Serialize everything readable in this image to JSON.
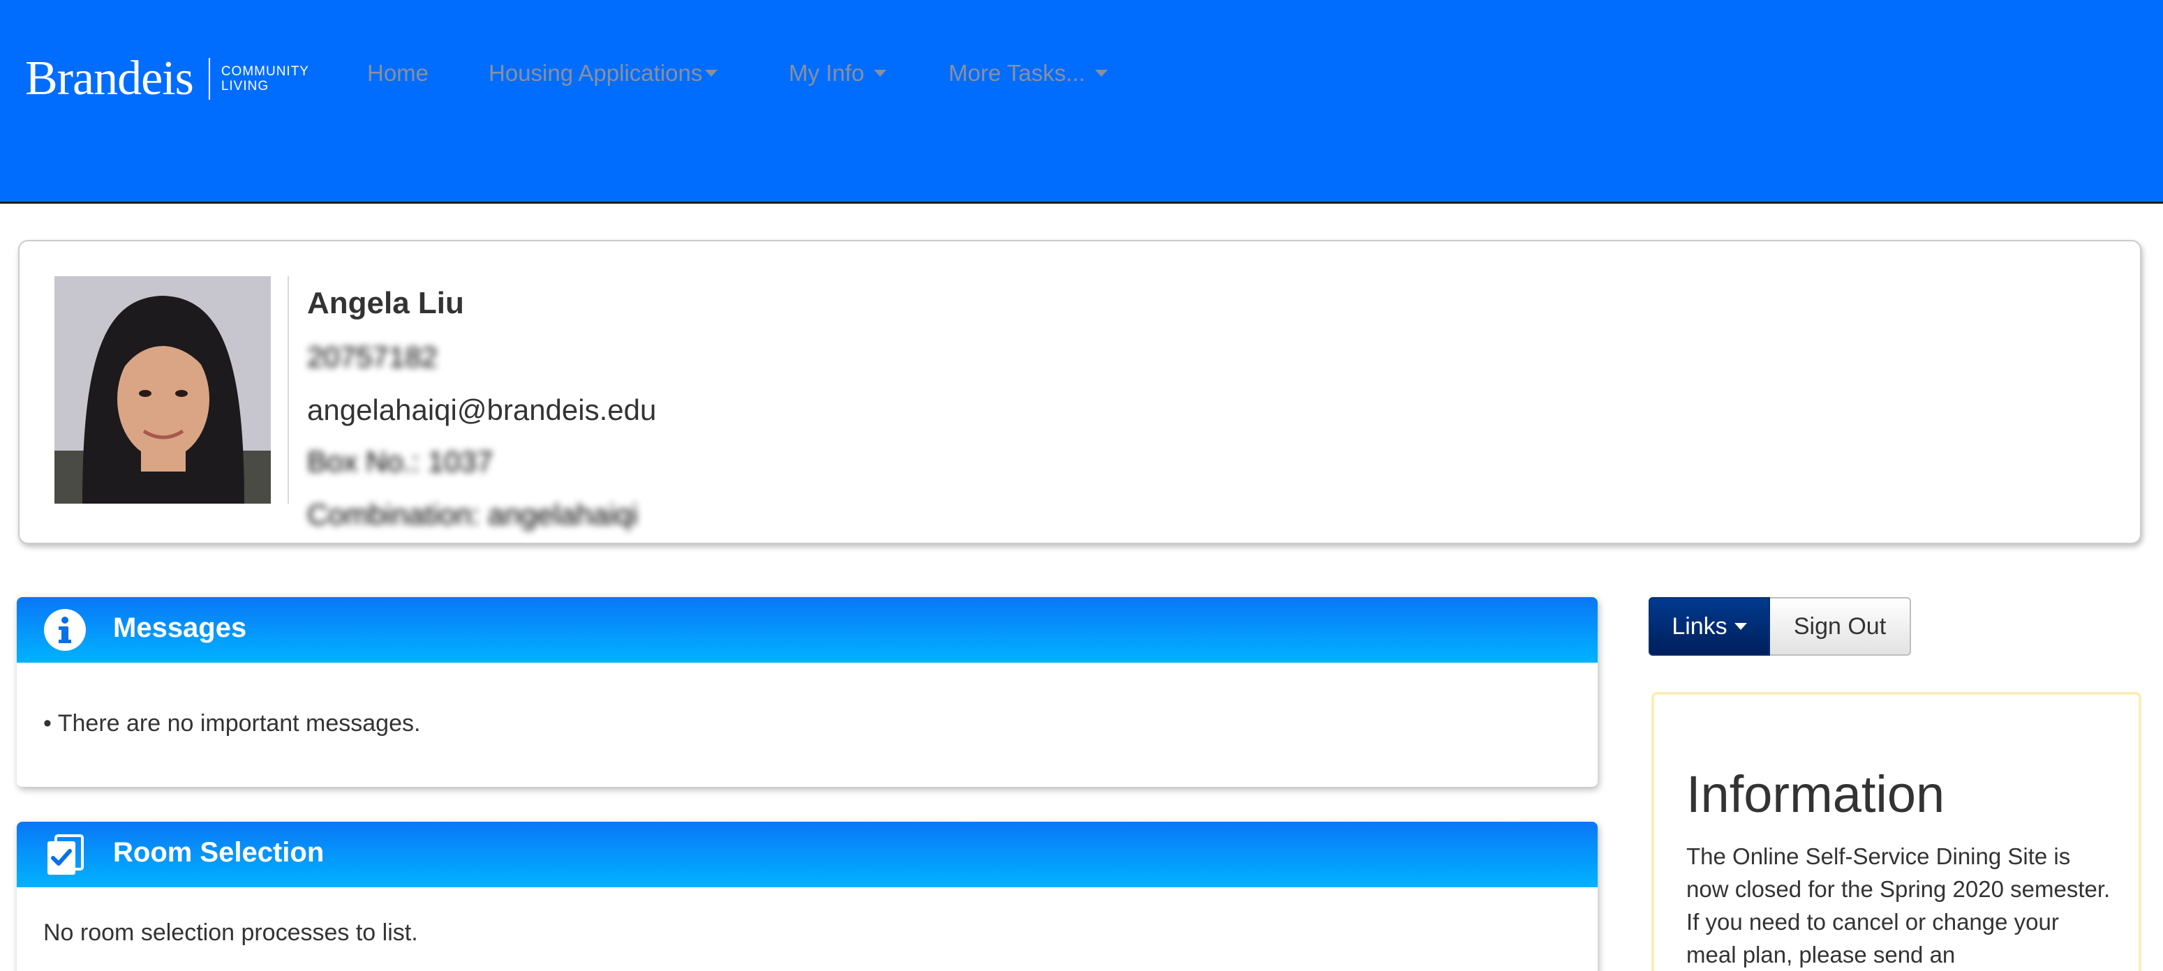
{
  "brand": {
    "wordmark": "Brandeis",
    "subtitle_line1": "COMMUNITY",
    "subtitle_line2": "LIVING"
  },
  "nav": {
    "items": [
      {
        "label": "Home"
      },
      {
        "label": "Housing Applications"
      },
      {
        "label": "My Info"
      },
      {
        "label": "More Tasks..."
      }
    ]
  },
  "profile": {
    "name": "Angela Liu",
    "student_id": "20757182",
    "email": "angelahaiqi@brandeis.edu",
    "box_no": "Box No.: 1037",
    "combination": "Combination: angelahaiqi"
  },
  "messages": {
    "title": "Messages",
    "icon": "info-circle-icon",
    "body": "• There are no important messages."
  },
  "room_selection": {
    "title": "Room Selection",
    "icon": "checklist-icon",
    "body": "No room selection processes to list."
  },
  "actions": {
    "links_label": "Links",
    "signout_label": "Sign Out"
  },
  "information": {
    "title": "Information",
    "text": "The Online Self-Service Dining Site is now closed for the Spring 2020 semester. If you need to cancel or change your meal plan, please send an"
  },
  "colors": {
    "navbar": "#006dff",
    "panel_header_top": "#0a77f7",
    "panel_header_bottom": "#00b3ff",
    "links_button": "#002a70",
    "info_border": "#fbeeb8"
  }
}
